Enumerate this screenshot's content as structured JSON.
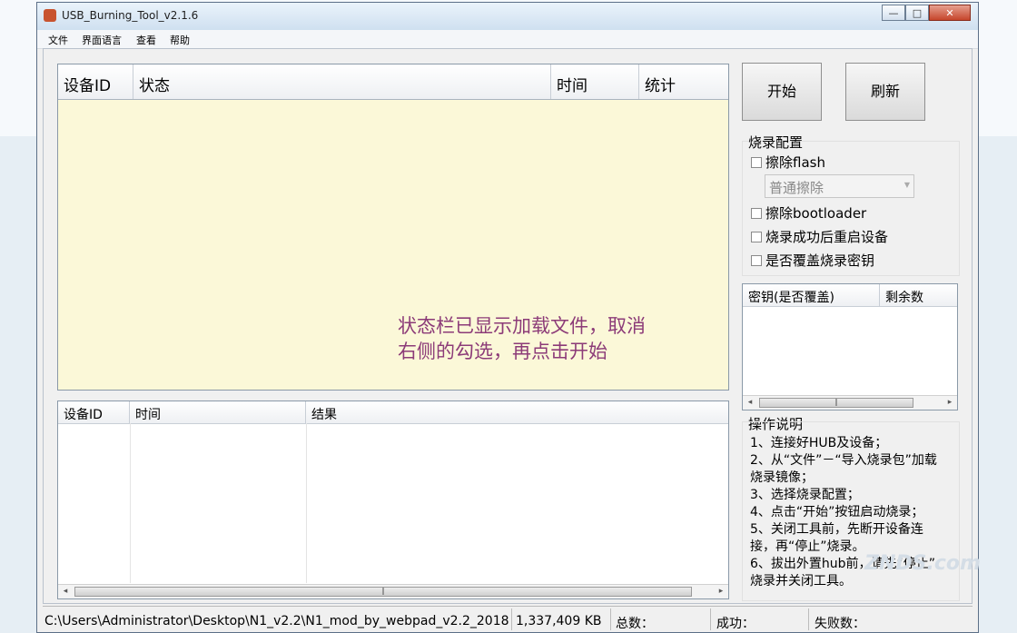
{
  "window": {
    "title": "USB_Burning_Tool_v2.1.6"
  },
  "menu": [
    "文件",
    "界面语言",
    "查看",
    "帮助"
  ],
  "device_list": {
    "columns": [
      "设备ID",
      "状态",
      "时间",
      "统计"
    ],
    "annotation": "状态栏已显示加载文件，取消右侧的勾选，再点击开始"
  },
  "result_list": {
    "columns": [
      "设备ID",
      "时间",
      "结果"
    ]
  },
  "buttons": {
    "start": "开始",
    "refresh": "刷新"
  },
  "burn_config": {
    "title": "烧录配置",
    "erase_flash": "擦除flash",
    "erase_mode_selected": "普通擦除",
    "erase_bootloader": "擦除bootloader",
    "reboot_after_success": "烧录成功后重启设备",
    "overwrite_key": "是否覆盖烧录密钥"
  },
  "key_list": {
    "columns": [
      "密钥(是否覆盖)",
      "剩余数"
    ]
  },
  "instructions": {
    "title": "操作说明",
    "lines": [
      "1、连接好HUB及设备；",
      "2、从“文件”－“导入烧录包”加载",
      "烧录镜像；",
      "3、选择烧录配置；",
      "4、点击“开始”按钮启动烧录；",
      "5、关闭工具前，先断开设备连",
      "接，再“停止”烧录。",
      "6、拔出外置hub前，请先“停止”",
      "烧录并关闭工具。"
    ]
  },
  "statusbar": {
    "path": "C:\\Users\\Administrator\\Desktop\\N1_v2.2\\N1_mod_by_webpad_v2.2_2018",
    "size": "1,337,409 KB",
    "total": "总数：",
    "success": "成功：",
    "fail": "失败数："
  },
  "watermark": "ZNDS.com"
}
